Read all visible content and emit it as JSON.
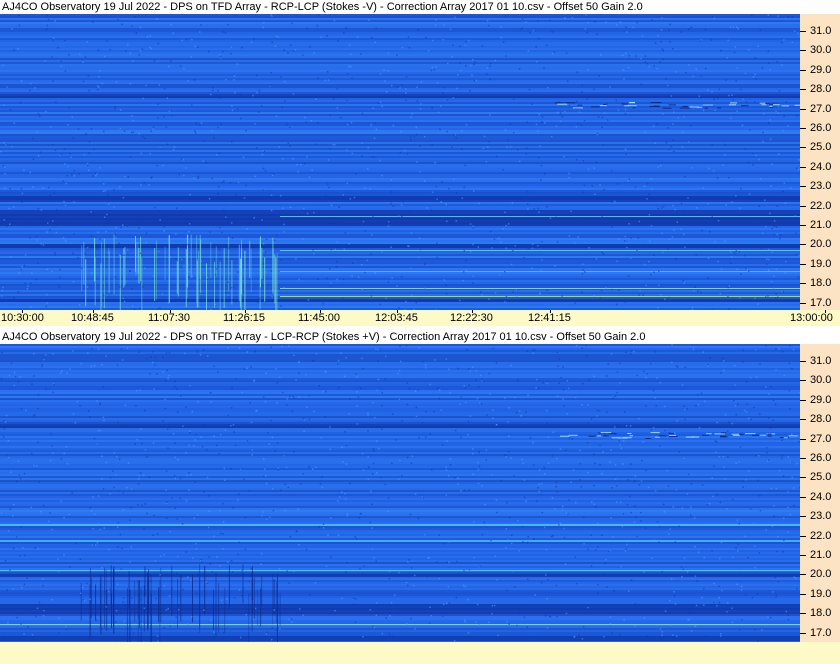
{
  "panels": [
    {
      "title": "AJ4CO Observatory 19 Jul 2022  -  DPS on TFD Array  -  RCP-LCP (Stokes -V)  -  Correction Array 2017 01 10.csv  -  Offset 50  Gain 2.0",
      "freq_labels": [
        "31.0",
        "30.0",
        "29.0",
        "28.0",
        "27.0",
        "26.0",
        "25.0",
        "24.0",
        "23.0",
        "22.0",
        "21.0",
        "20.0",
        "19.0",
        "18.0",
        "17.0"
      ],
      "time_labels": [
        "10:30:00",
        "10:48:45",
        "11:07:30",
        "11:26:15",
        "11:45:00",
        "12:03:45",
        "12:22:30",
        "12:41:15",
        "13:00:00"
      ]
    },
    {
      "title": "AJ4CO Observatory 19 Jul 2022  -  DPS on TFD Array  -  LCP-RCP (Stokes +V)  -  Correction Array 2017 01 10.csv  -  Offset 50  Gain 2.0",
      "freq_labels": [
        "31.0",
        "30.0",
        "29.0",
        "28.0",
        "27.0",
        "26.0",
        "25.0",
        "24.0",
        "23.0",
        "22.0",
        "21.0",
        "20.0",
        "19.0",
        "18.0",
        "17.0"
      ],
      "time_labels": []
    }
  ],
  "colors": {
    "spectrogram_base": "#1f5fe0",
    "freq_axis_bg": "#fce3c4",
    "time_axis_bg": "#fdfac8"
  }
}
